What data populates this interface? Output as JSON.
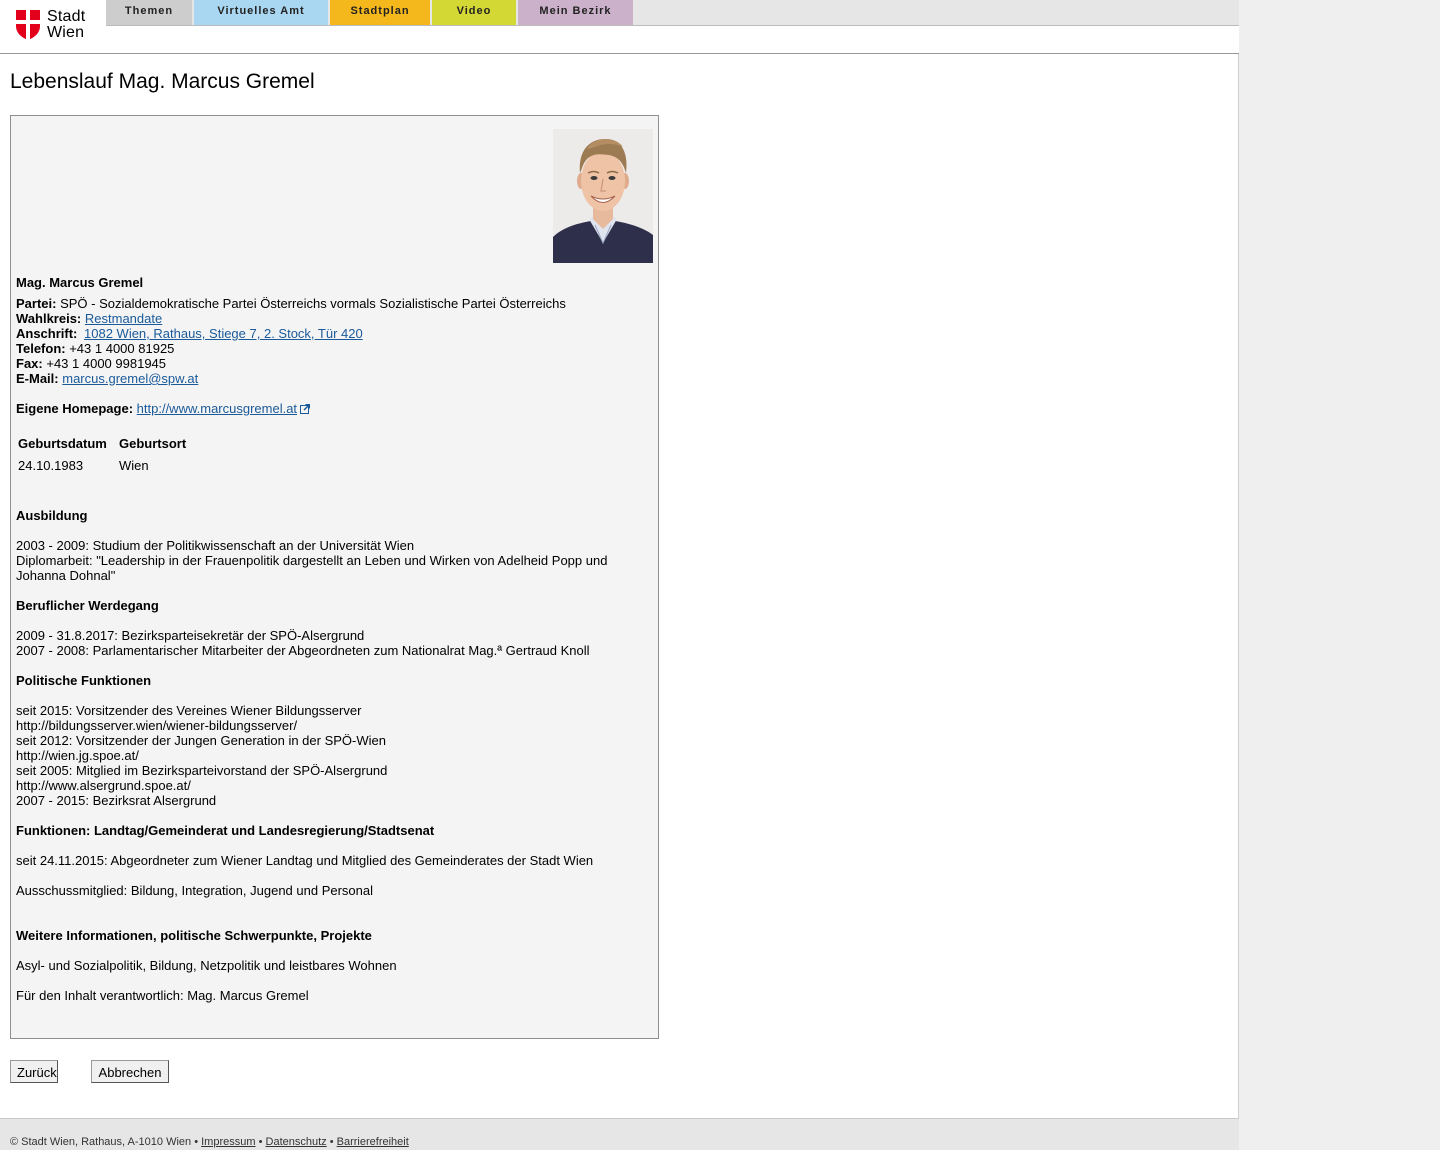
{
  "header": {
    "logo_text_1": "Stadt",
    "logo_text_2": "Wien",
    "tabs": [
      {
        "label": "Themen",
        "color": "#cdcdcd"
      },
      {
        "label": "Virtuelles Amt",
        "color": "#a9d7f1"
      },
      {
        "label": "Stadtplan",
        "color": "#f4b81c"
      },
      {
        "label": "Video",
        "color": "#d4d834"
      },
      {
        "label": "Mein Bezirk",
        "color": "#cbb2ca"
      }
    ]
  },
  "page_title": "Lebenslauf Mag. Marcus Gremel",
  "profile": {
    "name": "Mag. Marcus Gremel",
    "partei_label": "Partei:",
    "partei_value": "SPÖ - Sozialdemokratische Partei Österreichs vormals Sozialistische Partei Österreichs",
    "wahlkreis_label": "Wahlkreis:",
    "wahlkreis_value": "Restmandate",
    "anschrift_label": "Anschrift:",
    "anschrift_value": "1082 Wien, Rathaus, Stiege 7, 2. Stock, Tür 420",
    "telefon_label": "Telefon:",
    "telefon_value": "+43 1 4000 81925",
    "fax_label": "Fax:",
    "fax_value": "+43 1 4000 9981945",
    "email_label": "E-Mail:",
    "email_value": "marcus.gremel@spw.at",
    "homepage_label": "Eigene Homepage:",
    "homepage_value": "http://www.marcusgremel.at",
    "table": {
      "headers": [
        "Geburtsdatum",
        "Geburtsort"
      ],
      "values": [
        "24.10.1983",
        "Wien"
      ]
    }
  },
  "sections": {
    "ausbildung": {
      "heading": "Ausbildung",
      "lines": [
        "2003 - 2009: Studium der Politikwissenschaft an der Universität Wien",
        "Diplomarbeit: \"Leadership in der Frauenpolitik dargestellt an Leben und Wirken von Adelheid Popp und",
        "Johanna Dohnal\""
      ]
    },
    "werdegang": {
      "heading": "Beruflicher Werdegang",
      "lines": [
        "2009 - 31.8.2017: Bezirksparteisekretär der SPÖ-Alsergrund",
        "2007 - 2008: Parlamentarischer Mitarbeiter der Abgeordneten zum Nationalrat Mag.ª Gertraud Knoll"
      ]
    },
    "politisch": {
      "heading": "Politische Funktionen",
      "lines": [
        "seit 2015: Vorsitzender des Vereines Wiener Bildungsserver",
        "http://bildungsserver.wien/wiener-bildungsserver/",
        "seit 2012: Vorsitzender der Jungen Generation in der SPÖ-Wien",
        "http://wien.jg.spoe.at/",
        "seit 2005: Mitglied im Bezirksparteivorstand der SPÖ-Alsergrund",
        "http://www.alsergrund.spoe.at/",
        "2007 - 2015: Bezirksrat Alsergrund"
      ]
    },
    "funktionen": {
      "heading": "Funktionen: Landtag/Gemeinderat und Landesregierung/Stadtsenat",
      "line1": "seit 24.11.2015: Abgeordneter zum Wiener Landtag und Mitglied des Gemeinderates der Stadt Wien",
      "line2": "Ausschussmitglied: Bildung, Integration, Jugend und Personal"
    },
    "weitere": {
      "heading": "Weitere Informationen, politische Schwerpunkte, Projekte",
      "line1": "Asyl- und Sozialpolitik, Bildung, Netzpolitik und leistbares Wohnen",
      "line2": "Für den Inhalt verantwortlich: Mag. Marcus Gremel"
    }
  },
  "buttons": {
    "zurueck": "Zurück",
    "abbrechen": "Abbrechen"
  },
  "footer": {
    "copyright": "© Stadt Wien, Rathaus, A-1010 Wien",
    "sep": "•",
    "impressum": "Impressum",
    "datenschutz": "Datenschutz",
    "barrierefreiheit": "Barrierefreiheit"
  },
  "colors": {
    "link": "#1a5a9a",
    "logo_red": "#e2001a"
  }
}
